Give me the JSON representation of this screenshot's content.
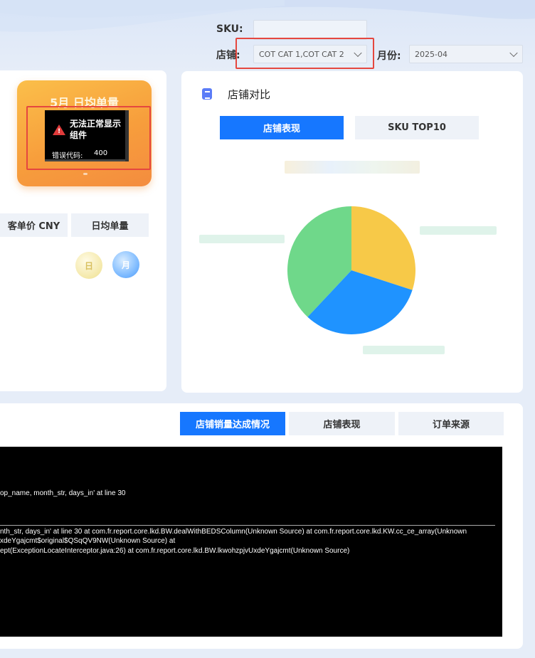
{
  "filters": {
    "sku_label": "SKU:",
    "sku_value": "",
    "store_label": "店铺:",
    "store_value": "COT CAT 1,COT CAT 2",
    "month_label": "月份:",
    "month_value": "2025-04"
  },
  "kpi": {
    "title": "5月 日均单量",
    "error_message": "无法正常显示组件",
    "error_code_label": "错误代码:",
    "error_code_value": "400"
  },
  "left_tabs": [
    {
      "label": "客单价 CNY"
    },
    {
      "label": "日均单量"
    }
  ],
  "round_icons": [
    {
      "label": "日",
      "icon": "day-badge-icon"
    },
    {
      "label": "月",
      "icon": "month-badge-icon"
    }
  ],
  "store_compare": {
    "title": "店铺对比",
    "tabs": [
      {
        "label": "店铺表现",
        "active": true
      },
      {
        "label": "SKU TOP10",
        "active": false
      }
    ]
  },
  "chart_data": {
    "type": "pie",
    "title": "",
    "labels": [],
    "values": [
      38,
      30,
      32
    ],
    "colors": [
      "#6fd88a",
      "#f7c948",
      "#1f93ff"
    ]
  },
  "bottom_tabs": [
    {
      "label": "店铺销量达成情况",
      "active": true
    },
    {
      "label": "店铺表现",
      "active": false
    },
    {
      "label": "订单来源",
      "active": false
    }
  ],
  "console": {
    "line1": "op_name, month_str, days_in' at line 30",
    "line2": "nth_str, days_in' at line 30 at com.fr.report.core.lkd.BW.dealWithBEDSColumn(Unknown Source) at com.fr.report.core.lkd.KW.cc_ce_array(Unknown",
    "line3": "xdeYgajcmt$original$QSqQV9NW(Unknown Source) at",
    "line4": "ept(ExceptionLocateInterceptor.java:26) at com.fr.report.core.lkd.BW.lkwohzpjvUxdeYgajcmt(Unknown Source)"
  },
  "colors": {
    "accent": "#1677ff",
    "highlight": "#e5473f",
    "kpi_orange": "#f79e3c"
  }
}
